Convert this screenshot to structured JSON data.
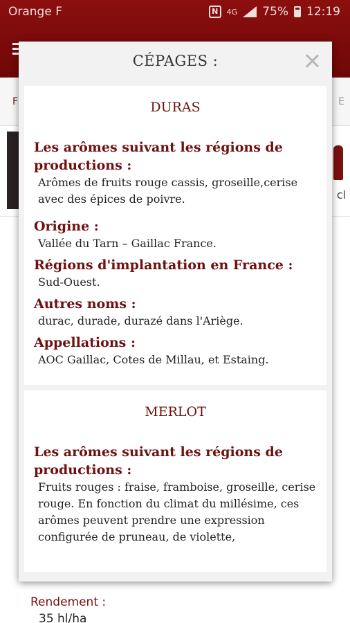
{
  "status_bar": {
    "carrier": "Orange F",
    "nfc": "N",
    "network": "4G",
    "battery": "75%",
    "time": "12:19"
  },
  "background": {
    "tab_left": "F",
    "tab_right": "E",
    "partial_text": "cl",
    "rendement_label": "Rendement :",
    "rendement_value": "35 hl/ha"
  },
  "modal": {
    "title": "CÉPAGES :",
    "close_icon": "close-icon",
    "cepages": [
      {
        "name": "DURAS",
        "sections": [
          {
            "heading": "Les arômes suivant les régions de productions :",
            "text": "Arômes de fruits rouge cassis, groseille,cerise avec des épices de poivre."
          },
          {
            "heading": "Origine :",
            "text": "Vallée du Tarn – Gaillac France."
          },
          {
            "heading": "Régions d'implantation en France :",
            "text": "Sud-Ouest."
          },
          {
            "heading": "Autres noms :",
            "text": "durac, durade, durazé dans l'Ariège."
          },
          {
            "heading": "Appellations :",
            "text": "AOC Gaillac, Cotes de Millau, et Estaing."
          }
        ]
      },
      {
        "name": "MERLOT",
        "sections": [
          {
            "heading": "Les arômes suivant les régions de productions :",
            "text": "Fruits rouges : fraise, framboise, groseille, cerise rouge. En fonction du climat du millésime, ces arômes peuvent prendre une expression configurée de pruneau, de violette,"
          }
        ]
      }
    ]
  },
  "colors": {
    "brand_red": "#8c0f0f",
    "heading_red": "#6d1010"
  }
}
